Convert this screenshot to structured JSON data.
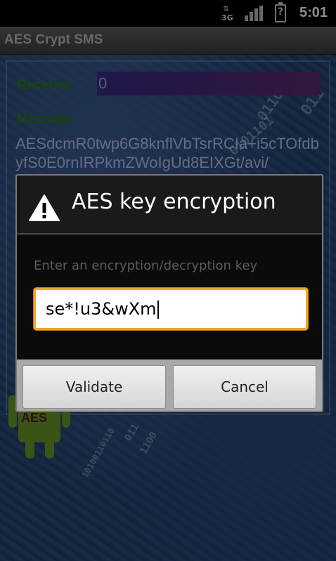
{
  "status_bar": {
    "network": "3G",
    "time": "5:01"
  },
  "app": {
    "title": "AES Crypt SMS",
    "receiver_label": "Receiver",
    "receiver_value": "0",
    "message_label": "Message",
    "message_value": "AESdcmR0twp6G8knflVbTsrRCIa+i5cTOfdbyfS0E0rnIRPkmZWoIgUd8EIXGt/avi/",
    "logo_text": "AES",
    "binary_fragments": [
      "0110",
      "011",
      "0101101",
      "011",
      "1100",
      "10100110110"
    ]
  },
  "dialog": {
    "title": "AES key encryption",
    "hint": "Enter an encryption/decryption key",
    "key_value": "se*!u3&wXm",
    "validate_label": "Validate",
    "cancel_label": "Cancel",
    "icon": "warning-icon"
  },
  "colors": {
    "accent_focus": "#f5a623",
    "label_green": "#2f7a1e",
    "dialog_bg": "#1c1c1c"
  }
}
